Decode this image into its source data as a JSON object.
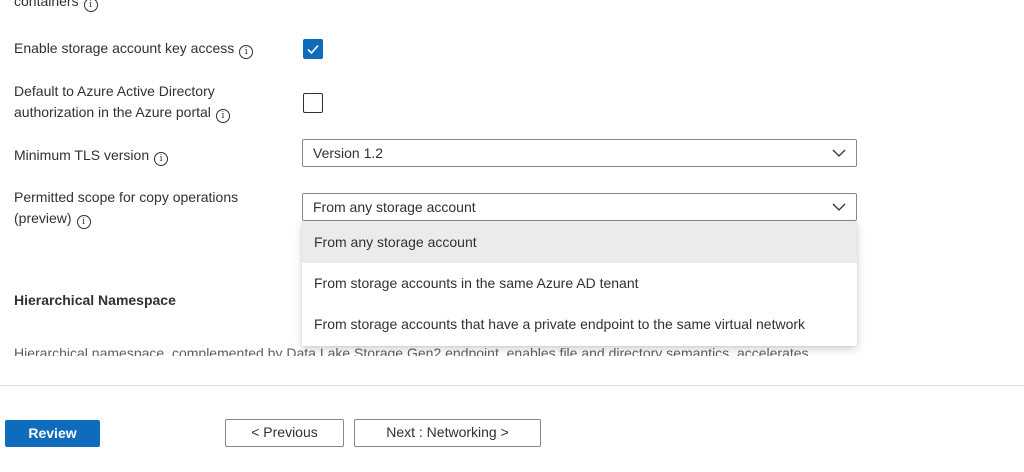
{
  "fields": {
    "cut_off_label": "containers",
    "key_access": {
      "label": "Enable storage account key access",
      "checked": true
    },
    "aad_default": {
      "label_line1": "Default to Azure Active Directory",
      "label_line2": "authorization in the Azure portal",
      "checked": false
    },
    "tls": {
      "label": "Minimum TLS version",
      "value": "Version 1.2"
    },
    "copy_scope": {
      "label_line1": "Permitted scope for copy operations",
      "label_line2": "(preview)",
      "value": "From any storage account",
      "options": [
        "From any storage account",
        "From storage accounts in the same Azure AD tenant",
        "From storage accounts that have a private endpoint to the same virtual network"
      ]
    }
  },
  "hierarchical": {
    "title": "Hierarchical Namespace",
    "description": "Hierarchical namespace, complemented by Data Lake Storage Gen2 endpoint, enables file and directory semantics, accelerates"
  },
  "footer": {
    "review_label": "Review",
    "previous_label": "< Previous",
    "next_label": "Next : Networking >"
  },
  "icons": {
    "info": "info-icon",
    "checkmark": "checkmark-icon",
    "chevron": "chevron-down-icon"
  },
  "colors": {
    "accent": "#0f6cbd",
    "selected_option_bg": "#edebe9"
  }
}
